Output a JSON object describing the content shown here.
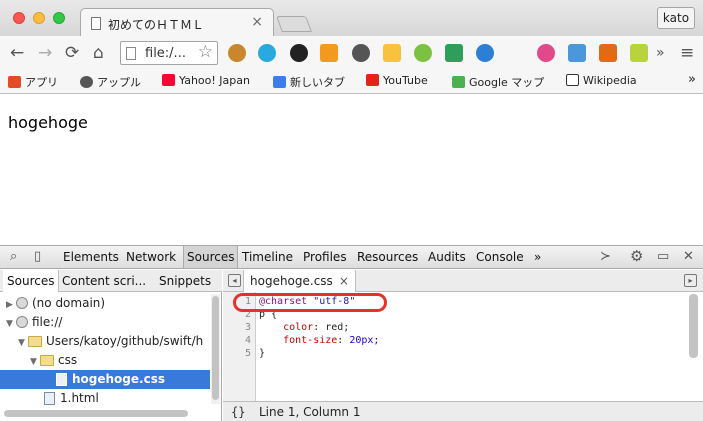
{
  "window": {
    "tab_title": "初めてのＨＴＭＬ",
    "profile": "kato"
  },
  "toolbar": {
    "back": "←",
    "forward": "→",
    "reload": "⟳",
    "home": "⌂",
    "address": "file:/...",
    "overflow": "»",
    "menu": "≡"
  },
  "bookmarks": [
    {
      "label": "アプリ",
      "icon": "apps-grid-icon",
      "color": "#e34c26"
    },
    {
      "label": "アップル",
      "icon": "apple-icon",
      "color": "#555555"
    },
    {
      "label": "Yahoo! Japan",
      "icon": "yahoo-icon",
      "color": "#ff0033"
    },
    {
      "label": "新しいタブ",
      "icon": "google-icon",
      "color": "#3b7de9"
    },
    {
      "label": "YouTube",
      "icon": "youtube-icon",
      "color": "#e62117"
    },
    {
      "label": "Google マップ",
      "icon": "maps-icon",
      "color": "#4caf50"
    },
    {
      "label": "Wikipedia",
      "icon": "wikipedia-icon",
      "color": "#333333"
    }
  ],
  "bookmarks_overflow": "»",
  "page": {
    "paragraph": "hogehoge"
  },
  "devtools": {
    "panels": [
      "Elements",
      "Network",
      "Sources",
      "Timeline",
      "Profiles",
      "Resources",
      "Audits",
      "Console"
    ],
    "active_panel": "Sources",
    "panels_overflow": "»",
    "navigator_tabs": [
      "Sources",
      "Content scri...",
      "Snippets"
    ],
    "tree": [
      {
        "label": "(no domain)",
        "icon": "globe-icon",
        "expanded": false
      },
      {
        "label": "file://",
        "icon": "globe-icon",
        "expanded": true
      },
      {
        "label": "Users/katoy/github/swift/h",
        "icon": "folder-icon",
        "expanded": true
      },
      {
        "label": "css",
        "icon": "folder-icon",
        "expanded": true
      },
      {
        "label": "hogehoge.css",
        "icon": "css-file-icon",
        "selected": true
      },
      {
        "label": "1.html",
        "icon": "html-file-icon"
      }
    ],
    "editor_tab": "hogehoge.css",
    "code": {
      "line1_at": "@charset",
      "line1_str": "\"utf-8\"",
      "line2": "p {",
      "line3_prop": "color",
      "line3_val": "red;",
      "line4_prop": "font-size",
      "line4_val": "20px;",
      "line5": "}"
    },
    "line_numbers": [
      "1",
      "2",
      "3",
      "4",
      "5"
    ],
    "pretty_print": "{}",
    "cursor_position": "Line 1, Column 1"
  }
}
